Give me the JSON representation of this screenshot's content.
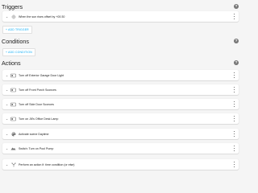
{
  "triggers": {
    "title": "Triggers",
    "help_icon": "question-circle-icon",
    "items": [
      {
        "label": "When the sun rises offset by +00:30",
        "icon": "sun-icon"
      }
    ],
    "add_button": "+ ADD TRIGGER"
  },
  "conditions": {
    "title": "Conditions",
    "help_icon": "question-circle-icon",
    "add_button": "+ ADD CONDITION"
  },
  "actions": {
    "title": "Actions",
    "help_icon": "question-circle-icon",
    "items": [
      {
        "label": "Turn off Exterior Garage Door Light",
        "icon": "device-icon"
      },
      {
        "label": "Turn off Front Porch Sconces",
        "icon": "device-icon"
      },
      {
        "label": "Turn off Side Door Sconces",
        "icon": "device-icon"
      },
      {
        "label": "Turn on Jill's Office Desk Lamp",
        "icon": "device-icon"
      },
      {
        "label": "Activate scene Daytime",
        "icon": "palette-icon"
      },
      {
        "label": "Switch: Turn on Pool Pump",
        "icon": "service-icon"
      },
      {
        "label": "Perform an action if: time condition (or else)",
        "icon": "branch-icon"
      }
    ]
  },
  "colors": {
    "accent": "#03a9f4",
    "card": "#ffffff",
    "background": "#f5f5f5"
  }
}
